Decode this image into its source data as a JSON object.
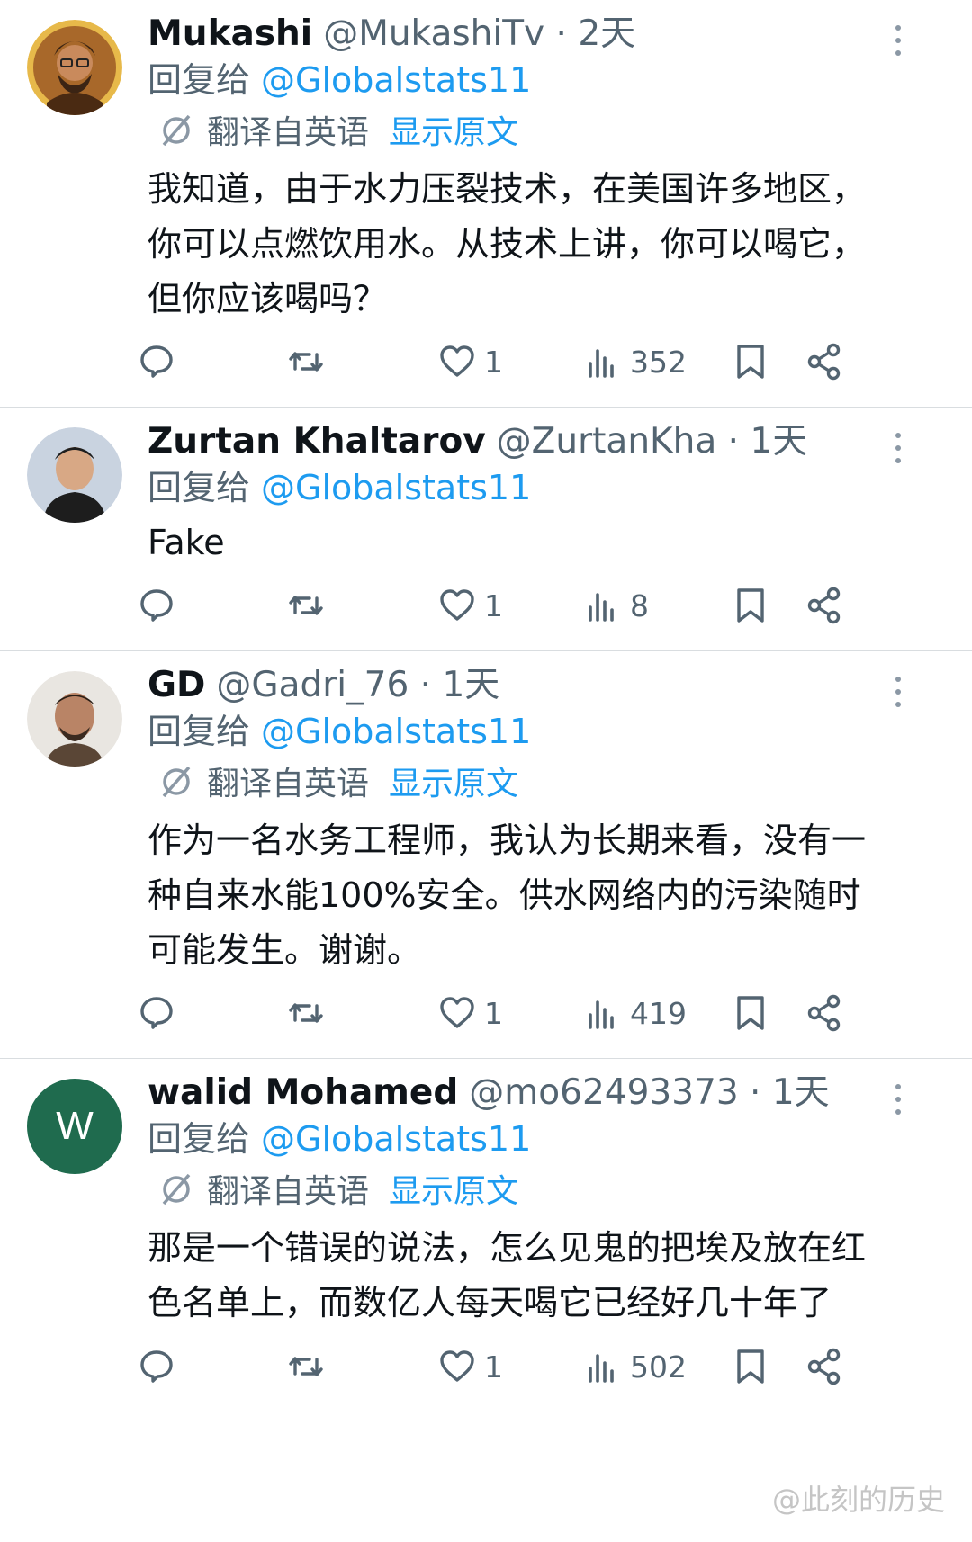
{
  "replies": [
    {
      "name": "Mukashi",
      "handle": "@MukashiTv",
      "time": "· 2天",
      "reply_prefix": "回复给",
      "reply_to": "@Globalstats11",
      "translated_from": "翻译自英语",
      "show_original": "显示原文",
      "text_lines": [
        "我知道，由于水力压裂技术，在美国许多地区，",
        "你可以点燃饮用水。从技术上讲，你可以喝它，",
        "但你应该喝吗？"
      ],
      "likes": "1",
      "views": "352"
    },
    {
      "name": "Zurtan Khaltarov",
      "handle": "@ZurtanKha",
      "time": "· 1天",
      "reply_prefix": "回复给",
      "reply_to": "@Globalstats11",
      "text_lines": [
        "Fake"
      ],
      "likes": "1",
      "views": "8"
    },
    {
      "name": "GD",
      "handle": "@Gadri_76",
      "time": "· 1天",
      "reply_prefix": "回复给",
      "reply_to": "@Globalstats11",
      "translated_from": "翻译自英语",
      "show_original": "显示原文",
      "text_lines": [
        "作为一名水务工程师，我认为长期来看，没有一",
        "种自来水能100%安全。供水网络内的污染随时",
        "可能发生。谢谢。"
      ],
      "likes": "1",
      "views": "419"
    },
    {
      "name": "walid Mohamed",
      "handle": "@mo62493373",
      "time": "· 1天",
      "reply_prefix": "回复给",
      "reply_to": "@Globalstats11",
      "translated_from": "翻译自英语",
      "show_original": "显示原文",
      "avatar_letter": "W",
      "text_lines": [
        "那是一个错误的说法，怎么见鬼的把埃及放在红",
        "色名单上，而数亿人每天喝它已经好几十年了"
      ],
      "likes": "1",
      "views": "502"
    }
  ],
  "colors": {
    "link": "#1d9bf0",
    "muted": "#536471",
    "text": "#0f1419",
    "divider": "#d9dde0"
  },
  "icons": [
    "reply-icon",
    "retweet-icon",
    "like-icon",
    "views-icon",
    "bookmark-icon",
    "share-icon",
    "more-icon",
    "translate-icon"
  ],
  "watermark": "@此刻的历史"
}
